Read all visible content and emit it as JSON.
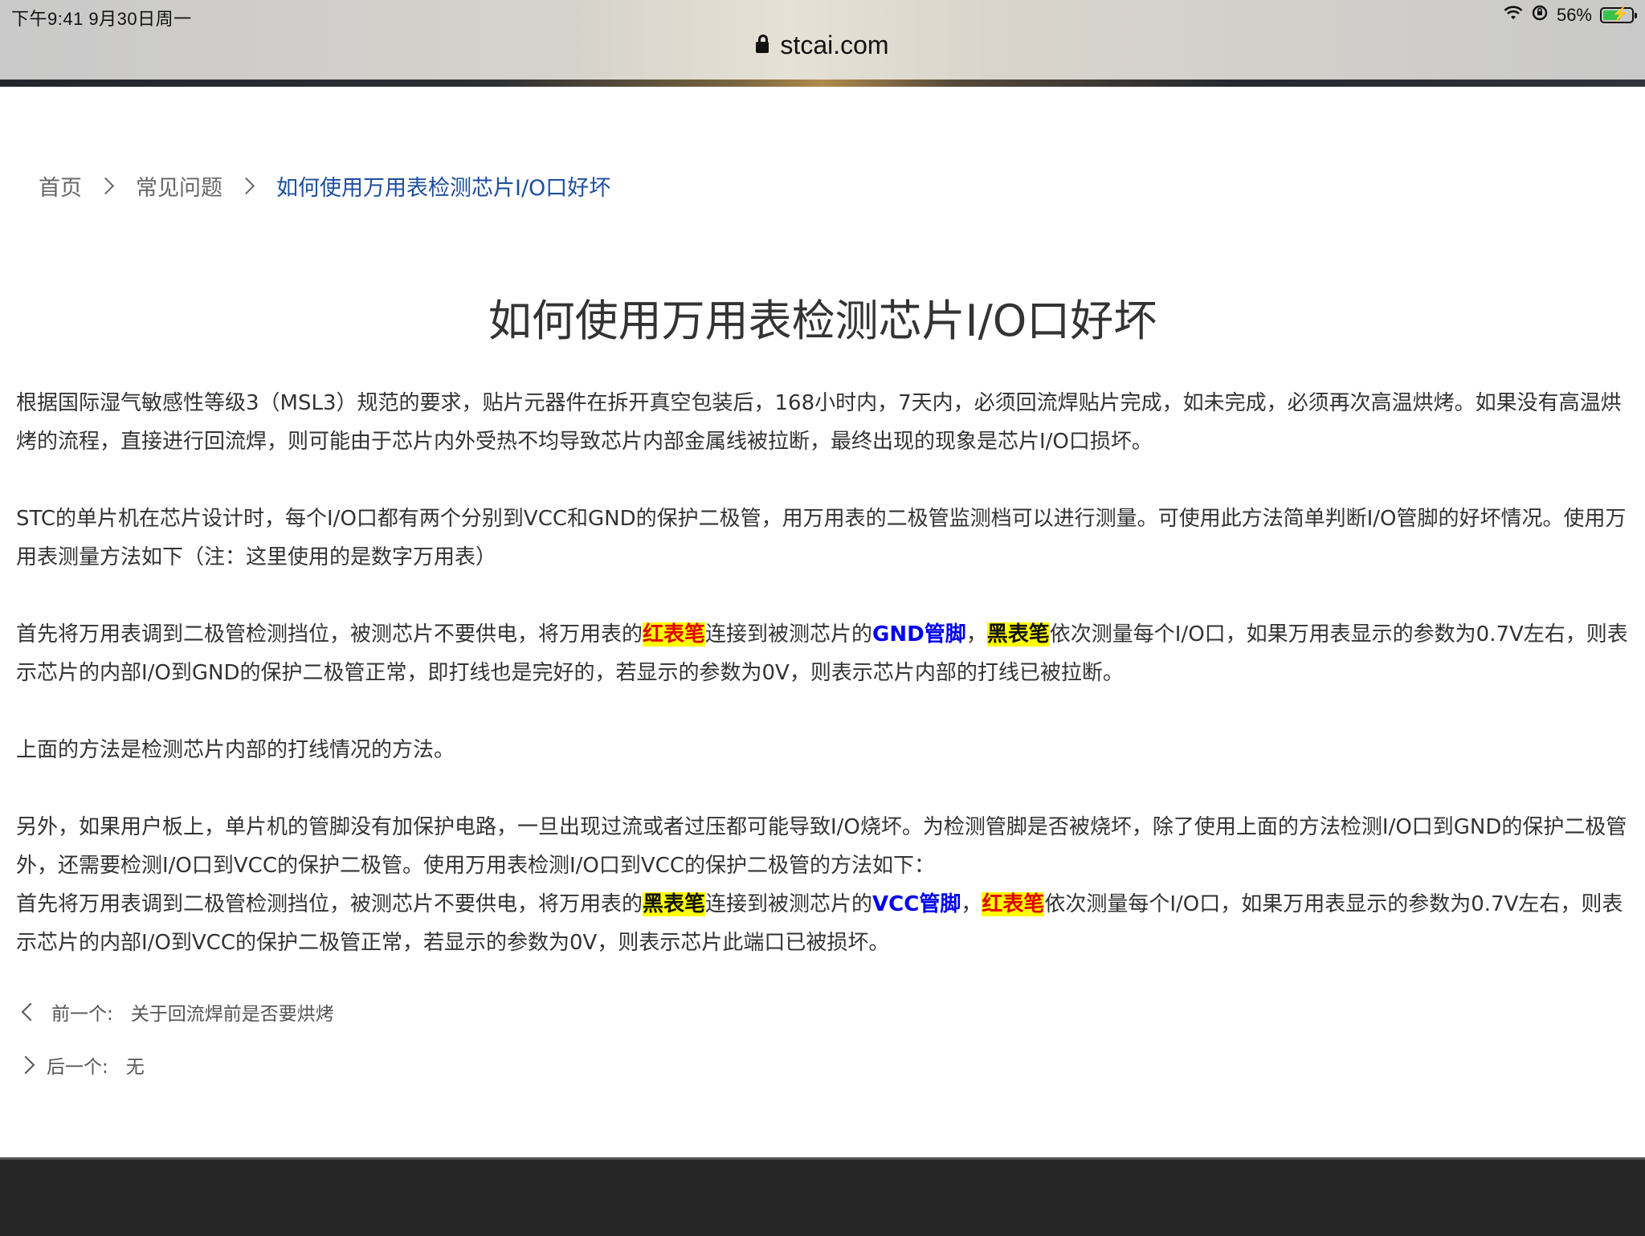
{
  "status_bar": {
    "time": "下午9:41   9月30日周一",
    "battery": "56%",
    "battery_level": 0.56
  },
  "browser": {
    "url": "stcai.com"
  },
  "breadcrumb": {
    "items": [
      "首页",
      "常见问题"
    ],
    "current": "如何使用万用表检测芯片I/O口好坏"
  },
  "article": {
    "title": "如何使用万用表检测芯片I/O口好坏",
    "p1": "根据国际湿气敏感性等级3（MSL3）规范的要求，贴片元器件在拆开真空包装后，168小时内，7天内，必须回流焊贴片完成，如未完成，必须再次高温烘烤。如果没有高温烘烤的流程，直接进行回流焊，则可能由于芯片内外受热不均导致芯片内部金属线被拉断，最终出现的现象是芯片I/O口损坏。",
    "p2": "STC的单片机在芯片设计时，每个I/O口都有两个分别到VCC和GND的保护二极管，用万用表的二极管监测档可以进行测量。可使用此方法简单判断I/O管脚的好坏情况。使用万用表测量方法如下（注：这里使用的是数字万用表）",
    "p3": {
      "t1": "首先将万用表调到二极管检测挡位，被测芯片不要供电，将万用表的",
      "h1": "红表笔",
      "t2": "连接到被测芯片的",
      "b1": "GND管脚",
      "t3": "，",
      "h2": "黑表笔",
      "t4": "依次测量每个I/O口，如果万用表显示的参数为0.7V左右，则表示芯片的内部I/O到GND的保护二极管正常，即打线也是完好的，若显示的参数为0V，则表示芯片内部的打线已被拉断。"
    },
    "p4": "上面的方法是检测芯片内部的打线情况的方法。",
    "p5": "另外，如果用户板上，单片机的管脚没有加保护电路，一旦出现过流或者过压都可能导致I/O烧坏。为检测管脚是否被烧坏，除了使用上面的方法检测I/O口到GND的保护二极管外，还需要检测I/O口到VCC的保护二极管。使用万用表检测I/O口到VCC的保护二极管的方法如下：",
    "p6": {
      "t1": "首先将万用表调到二极管检测挡位，被测芯片不要供电，将万用表的",
      "h1": "黑表笔",
      "t2": "连接到被测芯片的",
      "b1": "VCC管脚",
      "t3": "，",
      "h2": "红表笔",
      "t4": "依次测量每个I/O口，如果万用表显示的参数为0.7V左右，则表示芯片的内部I/O到VCC的保护二极管正常，若显示的参数为0V，则表示芯片此端口已被损坏。"
    }
  },
  "pager": {
    "prev_label": "前一个:",
    "prev_title": "关于回流焊前是否要烘烤",
    "next_label": "后一个:",
    "next_title": "无"
  },
  "colors": {
    "breadcrumb_current": "#1d4e9e",
    "highlight_bg": "#ffff00",
    "red_pen": "#e00000",
    "pin_blue": "#0000ee",
    "footer_bg": "#262626"
  }
}
